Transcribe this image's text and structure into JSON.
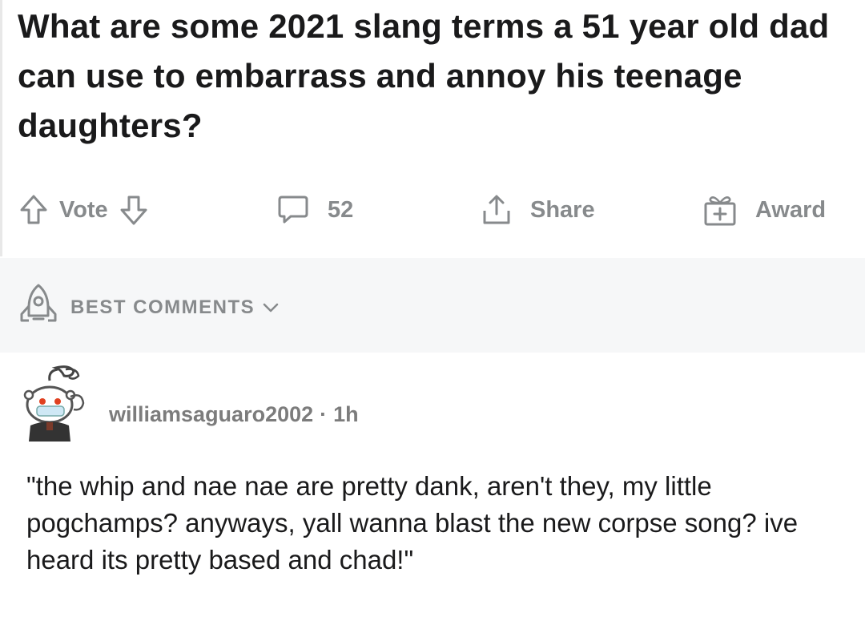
{
  "post": {
    "title": "What are some 2021 slang terms a 51 year old dad can use to embarrass and annoy his teenage daughters?"
  },
  "actions": {
    "vote_label": "Vote",
    "comment_count": "52",
    "share_label": "Share",
    "award_label": "Award"
  },
  "sort": {
    "label": "BEST COMMENTS"
  },
  "comment": {
    "username": "williamsaguaro2002",
    "separator": "·",
    "age": "1h",
    "body": "\"the whip and nae nae are pretty dank, aren't they, my little pogchamps? anyways, yall wanna blast the new corpse song? ive heard its pretty based and chad!\""
  },
  "icons": {
    "upvote": "upvote-arrow-icon",
    "downvote": "downvote-arrow-icon",
    "comment": "comment-bubble-icon",
    "share": "share-icon",
    "award": "gift-award-icon",
    "sort": "rocket-icon",
    "dropdown": "chevron-down-icon"
  },
  "colors": {
    "text": "#1a1a1b",
    "muted": "#878a8c",
    "sort_bg": "#f6f7f8"
  }
}
